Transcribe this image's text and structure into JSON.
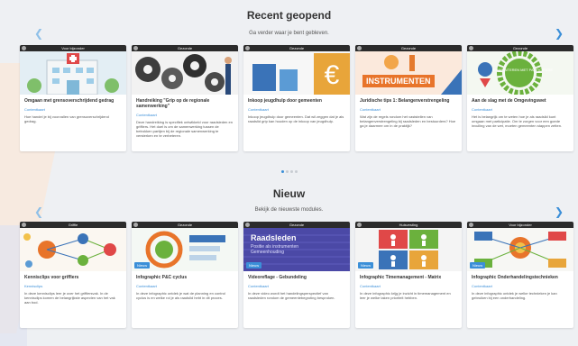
{
  "recent": {
    "title": "Recent geopend",
    "subtitle": "Ga verder waar je bent gebleven.",
    "cards": [
      {
        "head": "Voor bijzonder",
        "title": "Omgaan met grensoverschrijdend gedrag",
        "category": "Contentkaart",
        "desc": "Hoe handel je bij voorvallen van grensoverschrijdend gedrag."
      },
      {
        "head": "Gezonde",
        "title": "Handreiking \"Grip op de regionale samenwerking\"",
        "category": "Contentkaart",
        "desc": "Deze handreiking is specifiek ontwikkeld voor raadsleden en griffiers. Het doel is om de samenwerking tussen de betrokken partijen bij de regionale samenwerking te versterken en te verbeteren."
      },
      {
        "head": "Gezonde",
        "title": "Inkoop jeugdhulp door gemeenten",
        "category": "Contentkaart",
        "desc": "Inkoop jeugdhulp door gemeenten. Dat wil zeggen dat je als raadslid grip kan houden op de inkoop van jeugdhulp."
      },
      {
        "head": "Gezonde",
        "title": "Juridische tips 1: Belangenverstrengeling",
        "category": "Contentkaart",
        "desc": "Wat zijn de regels rondom het vaststellen van belangenverstrengeling bij raadsleden en bestuurders? Hoe ga je daarmee om in de praktijk?"
      },
      {
        "head": "Gezonde",
        "title": "Aan de slag met de Omgevingswet",
        "category": "Contentkaart",
        "desc": "Het is belangrijk om te weten hoe je als raadslid kunt omgaan met participatie. Om te zorgen voor een goede invulling van de wet, moeten gemeenten stappen zetten."
      }
    ],
    "dots": 4,
    "active_dot": 0
  },
  "new": {
    "title": "Nieuw",
    "subtitle": "Bekijk de nieuwste modules.",
    "cards": [
      {
        "head": "Griffie",
        "title": "Kennisclips voor griffiers",
        "category": "Kennisclips",
        "desc": "In deze kennisclips leer je over het griffiersvak. In de kennisclips komen de belangrijkste aspecten van het vak aan bod.",
        "badge": ""
      },
      {
        "head": "Gezonde",
        "title": "Infographic P&C cyclus",
        "category": "Contentkaart",
        "desc": "In deze infographic ontdek je wat de planning en control cyclus is en welke rol je als raadslid hebt in dit proces.",
        "badge": "Nieuw"
      },
      {
        "head": "Gezonde",
        "title": "Videoreflage - Gebundeling",
        "category": "Contentkaart",
        "desc": "In deze video wordt het handelingsperspectief van raadsleden rondom de gemeentebegroting besproken.",
        "badge": "Nieuw"
      },
      {
        "head": "Huisvesting",
        "title": "Infographic Timemanagement - Matrix",
        "category": "Contentkaart",
        "desc": "In deze infographic krijg je inzicht in timemanagement en leer je welke taken prioriteit hebben.",
        "badge": "Nieuw"
      },
      {
        "head": "Voor bijzonder",
        "title": "Infographic Onderhandelingstechnieken",
        "category": "Contentkaart",
        "desc": "In deze infographic ontdek je welke technieken je kan gebruiken bij een onderhandeling.",
        "badge": "Nieuw"
      }
    ],
    "dots": 10,
    "active_dot": 0
  },
  "thumb_texts": {
    "recent_2_sign": "INSTRUMENTEN",
    "recent_3_symbol": "€",
    "recent_4_label": "EXPERIMENTEREN MET PARTICIPATIE",
    "new_2_heading": "Raadsleden",
    "new_2_line1": "Positie als instrumenten",
    "new_2_line2": "Gemeenhouding"
  },
  "colors": {
    "accent": "#3b8fd8",
    "background": "#eef0f3",
    "card_head": "#2b2b2b"
  }
}
